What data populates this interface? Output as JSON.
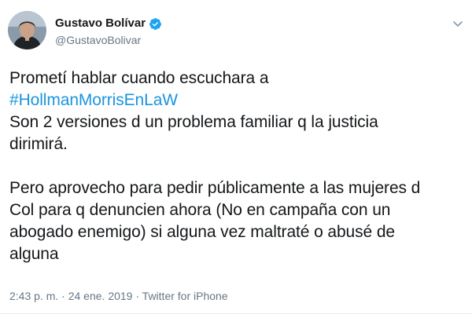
{
  "user": {
    "display_name": "Gustavo Bolívar",
    "handle": "@GustavoBolivar",
    "verified": true,
    "avatar_icon": "profile-photo"
  },
  "tweet": {
    "line1": "Prometí hablar cuando escuchara a",
    "hashtag": "#HollmanMorrisEnLaW",
    "line3": "Son 2 versiones d un problema familiar q la justicia",
    "line4": "dirimirá.",
    "line5": "Pero aprovecho para pedir públicamente a las mujeres d",
    "line6": "Col para q denuncien ahora (No en campaña con un",
    "line7": "abogado enemigo) si alguna vez maltraté o abusé de",
    "line8": "alguna"
  },
  "meta": {
    "time": "2:43 p. m.",
    "separator1": " · ",
    "date": "24 ene. 2019",
    "separator2": " · ",
    "source": "Twitter for iPhone"
  },
  "colors": {
    "link": "#1b95e0",
    "secondary_text": "#657786",
    "verified_badge": "#1da1f2"
  },
  "icons": {
    "menu": "chevron-down-icon",
    "verified": "verified-badge-icon"
  }
}
